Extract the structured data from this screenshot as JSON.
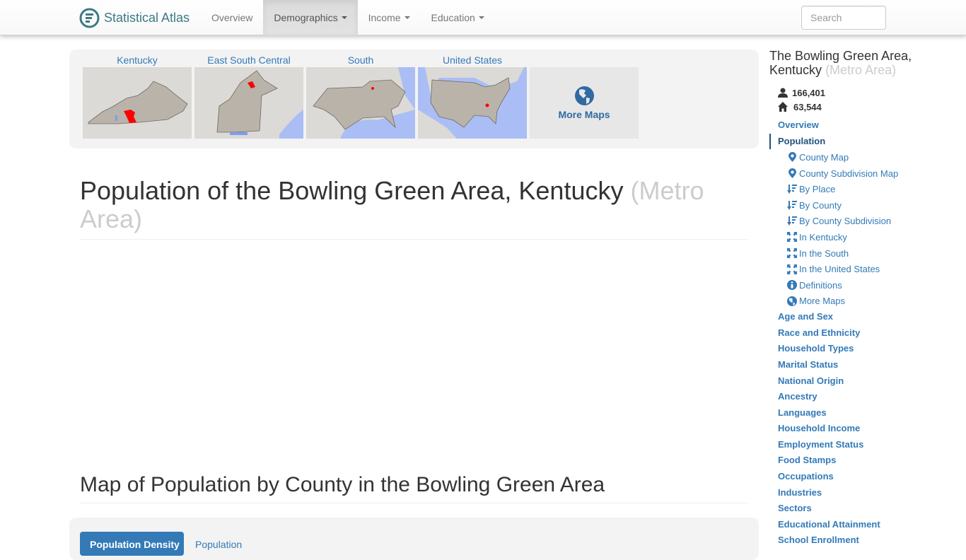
{
  "navbar": {
    "brand": "Statistical Atlas",
    "items": [
      {
        "label": "Overview",
        "dropdown": false,
        "active": false
      },
      {
        "label": "Demographics",
        "dropdown": true,
        "active": true
      },
      {
        "label": "Income",
        "dropdown": true,
        "active": false
      },
      {
        "label": "Education",
        "dropdown": true,
        "active": false
      }
    ],
    "search_placeholder": "Search"
  },
  "map_strip": {
    "thumbnails": [
      {
        "label": "Kentucky"
      },
      {
        "label": "East South Central"
      },
      {
        "label": "South"
      },
      {
        "label": "United States"
      }
    ],
    "more_maps": "More Maps"
  },
  "main": {
    "title": "Population of the Bowling Green Area, Kentucky",
    "title_suffix": "(Metro Area)",
    "section_title": "Map of Population by County in the Bowling Green Area",
    "tabs": {
      "active": "Population Density",
      "other": "Population"
    }
  },
  "sidebar": {
    "title": "The Bowling Green Area, Kentucky",
    "title_suffix": "(Metro Area)",
    "population": "166,401",
    "households": "63,544",
    "nav": {
      "overview": "Overview",
      "population": "Population",
      "sub": [
        {
          "label": "County Map",
          "icon": "map-marker-icon"
        },
        {
          "label": "County Subdivision Map",
          "icon": "map-marker-icon"
        },
        {
          "label": "By Place",
          "icon": "sort-icon"
        },
        {
          "label": "By County",
          "icon": "sort-icon"
        },
        {
          "label": "By County Subdivision",
          "icon": "sort-icon"
        },
        {
          "label": "In Kentucky",
          "icon": "zoom-out-icon"
        },
        {
          "label": "In the South",
          "icon": "zoom-out-icon"
        },
        {
          "label": "In the United States",
          "icon": "zoom-out-icon"
        },
        {
          "label": "Definitions",
          "icon": "info-icon"
        },
        {
          "label": "More Maps",
          "icon": "globe-icon"
        }
      ],
      "sections": [
        "Age and Sex",
        "Race and Ethnicity",
        "Household Types",
        "Marital Status",
        "National Origin",
        "Ancestry",
        "Languages",
        "Household Income",
        "Employment Status",
        "Food Stamps",
        "Occupations",
        "Industries",
        "Sectors",
        "Educational Attainment",
        "School Enrollment"
      ]
    }
  },
  "colors": {
    "link": "#337ab7",
    "brand": "#3b7a84",
    "highlight": "#ff0000",
    "water": "#aabef5"
  }
}
